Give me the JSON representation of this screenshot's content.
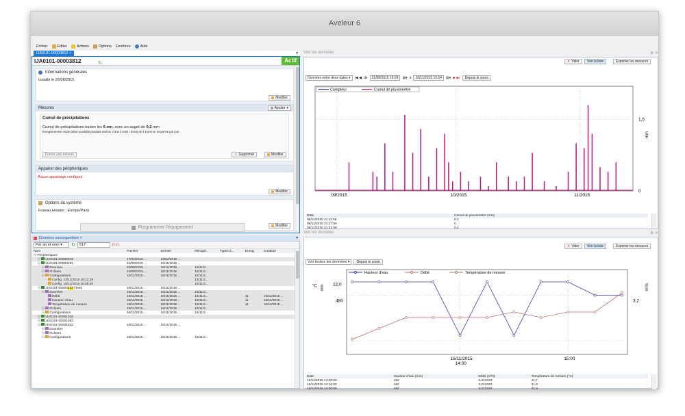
{
  "app": {
    "title": "Aveleur 6"
  },
  "menu": [
    {
      "label": "Fichier",
      "icon": ""
    },
    {
      "label": "Editer",
      "icon": "pencil-icon"
    },
    {
      "label": "Actions",
      "icon": "lightning-icon"
    },
    {
      "label": "Options",
      "icon": "wrench-icon"
    },
    {
      "label": "Fenêtres",
      "icon": ""
    },
    {
      "label": "Aide",
      "icon": "help-icon"
    }
  ],
  "left_tab": {
    "label": "IJA0101-00003812 ×"
  },
  "device": {
    "name": "IJA0101-00003812",
    "status": "Actif"
  },
  "info": {
    "heading": "Informations générales",
    "installed": "Installé le 25/08/2015",
    "modify": "Modifier"
  },
  "mesures": {
    "heading": "Mesures",
    "add": "Ajouter",
    "card_title": "Cumul de précipitations",
    "desc_pre": "Cumul de précipitations toutes les ",
    "desc_b1": "6 mn",
    "desc_mid": ", avec un auget de ",
    "desc_b2": "0,2",
    "desc_post": " mm",
    "note": "Enregistrement mode piéton possible pendant environ 2 ans 3 mois / Envoi de 4.8 ans en moyenne par jour",
    "force": "Forcer une mesure",
    "delete": "Supprimer",
    "modify": "Modifier"
  },
  "peripherals": {
    "heading": "Appairer des périphériques",
    "none": "Aucun appairage configuré",
    "modify": "Modifier"
  },
  "system": {
    "heading": "Options du système",
    "timezone": "Fuseau Horaire : Europe/Paris",
    "modify": "Modifier"
  },
  "program_button": "Programmer l'équipement",
  "saved": {
    "tab": "Données sauvegardées ×",
    "filter": "Par an et nom",
    "count": "517",
    "columns": [
      "Nom",
      "Premier",
      "Dernier",
      "Récupé...",
      "Types d...",
      "Enreg.",
      "Création"
    ],
    "rows": [
      {
        "ind": 0,
        "icon": "",
        "name": "Périphériques",
        "c": [
          "",
          "",
          "",
          "",
          "",
          ""
        ]
      },
      {
        "ind": 1,
        "icon": "signal",
        "name": "IJA0101-00000015",
        "c": [
          "17/02/2015 ...",
          "19/02/2015 ...",
          "",
          "",
          "",
          ""
        ],
        "g": 1
      },
      {
        "ind": 1,
        "icon": "signal",
        "name": "IJA0101-00000191",
        "c": [
          "24/09/2015 ...",
          "16/11/2015 ...",
          "",
          "",
          "",
          ""
        ]
      },
      {
        "ind": 2,
        "icon": "data",
        "name": "Données",
        "c": [
          "24/09/2015 ...",
          "16/11/2015 ...",
          "16/11/2...",
          "",
          "",
          ""
        ],
        "g": 1
      },
      {
        "ind": 2,
        "icon": "data",
        "name": "Fichiers",
        "c": [
          "24/09/2015 ...",
          "16/11/2015 ...",
          "16/11/2...",
          "",
          "",
          ""
        ],
        "g": 1
      },
      {
        "ind": 2,
        "icon": "cfg",
        "name": "Configurations",
        "c": [
          "13/11/2015 ...",
          "16/11/2015 ...",
          "16/11/2...",
          "",
          "",
          ""
        ],
        "g": 1
      },
      {
        "ind": 3,
        "icon": "cfg",
        "name": "Config. 13/11/2015 18:12:39",
        "c": [
          "",
          "",
          "13/11/2...",
          "",
          "",
          ""
        ],
        "g": 1
      },
      {
        "ind": 3,
        "icon": "cfg",
        "name": "Config. 16/11/2015 16:09:30",
        "c": [
          "",
          "",
          "16/11/2...",
          "",
          "",
          ""
        ],
        "g": 1
      },
      {
        "ind": 1,
        "icon": "signal",
        "name": "IJA0101-00000",
        "hl": "413",
        "suffix": " (Test)",
        "c": [
          "16/11/2015 ...",
          "16/11/2015 ...",
          "",
          "",
          "",
          ""
        ]
      },
      {
        "ind": 2,
        "icon": "data",
        "name": "Données",
        "c": [
          "16/11/2015 ...",
          "16/11/2015 ...",
          "16/11/2...",
          "",
          "",
          ""
        ],
        "g": 1
      },
      {
        "ind": 3,
        "icon": "data",
        "name": "Débit",
        "c": [
          "16/11/2015 ...",
          "16/11/2015 ...",
          "16/11/2...",
          "",
          "11",
          "16/11/2015 ..."
        ],
        "g": 1
      },
      {
        "ind": 3,
        "icon": "data",
        "name": "Hauteur d'eau",
        "c": [
          "16/11/2015 ...",
          "16/11/2015 ...",
          "16/11/2...",
          "",
          "11",
          "16/11/2015 ..."
        ],
        "g": 1
      },
      {
        "ind": 3,
        "icon": "data",
        "name": "Température de mesure",
        "c": [
          "16/11/2015 ...",
          "16/11/2015 ...",
          "16/11/2...",
          "",
          "11",
          "16/11/2015 ..."
        ],
        "g": 1
      },
      {
        "ind": 2,
        "icon": "data",
        "name": "Fichiers",
        "c": [
          "16/11/2015 ...",
          "16/11/2015 ...",
          "16/11/2...",
          "",
          "",
          ""
        ],
        "g": 1
      },
      {
        "ind": 2,
        "icon": "cfg",
        "name": "Configurations",
        "c": [
          "16/11/2015 ...",
          "16/11/2015 ...",
          "16/11/2...",
          "",
          "",
          ""
        ]
      },
      {
        "ind": 1,
        "icon": "signal",
        "name": "IJA0101-00001016",
        "c": [
          "",
          "",
          "",
          "",
          "",
          ""
        ],
        "g": 1
      },
      {
        "ind": 1,
        "icon": "signal",
        "name": "IJA0101-00001093",
        "c": [
          "",
          "",
          "",
          "",
          "",
          ""
        ]
      },
      {
        "ind": 1,
        "icon": "signal",
        "name": "IJA0101-00001532",
        "c": [
          "16/11/2015 ...",
          "16/11/2015 ...",
          "",
          "",
          "",
          ""
        ]
      },
      {
        "ind": 2,
        "icon": "data",
        "name": "Données",
        "c": [
          "",
          "",
          "",
          "",
          "",
          ""
        ]
      },
      {
        "ind": 2,
        "icon": "data",
        "name": "Fichiers",
        "c": [
          "",
          "",
          "",
          "",
          "",
          ""
        ]
      },
      {
        "ind": 2,
        "icon": "cfg",
        "name": "Configurations",
        "c": [
          "16/11/2015 ...",
          "16/11/2015 ...",
          "16/11/2...",
          "",
          "",
          ""
        ]
      }
    ]
  },
  "view1": {
    "title": "Voir les données",
    "clear": "Vider",
    "list": "Voir la liste",
    "export": "Exporter les mesures",
    "range": "Données entre deux dates",
    "de": "de",
    "date_from": "31/08/2015 16:29",
    "a": "à",
    "date_to": "16/11/2015 15:54",
    "zoom": "Depuis le zoom",
    "table": {
      "columns": [
        "Date",
        "Cumul de pluviomètre (mm)"
      ],
      "rows": [
        [
          "06/11/2015 21:11:59",
          "0,2"
        ],
        [
          "06/11/2015 21:17:59",
          "0"
        ],
        [
          "06/11/2015 21:23:59",
          "0,4"
        ]
      ]
    }
  },
  "view2": {
    "title": "Voir les données",
    "clear": "Vider",
    "list": "Voir la liste",
    "export": "Exporter les mesures",
    "range": "Voir toutes les données",
    "zoom": "Depuis le zoom",
    "table": {
      "columns": [
        "Date",
        "Hauteur d'eau (mm)",
        "Débit (m³/s)",
        "Température de mesure (°C)"
      ],
      "rows": [
        [
          "16/11/2015 13:00:00",
          "482",
          "3,213333",
          "21,7"
        ],
        [
          "16/11/2015 13:15:00",
          "482",
          "3,213333",
          "21,8"
        ],
        [
          "16/11/2015 13:30:00",
          "482",
          "3,213333",
          "21,9"
        ]
      ]
    }
  },
  "chart_data": [
    {
      "type": "bar",
      "legend": [
        "Compteur",
        "Cumul de pluviomètre"
      ],
      "x_ticks": [
        "09/2015",
        "10/2015",
        "11/2015"
      ],
      "y_ticks": [
        "0",
        "1,5"
      ],
      "ylabel": "mm",
      "ylim": [
        0,
        2.2
      ],
      "colors": {
        "series": "#c0147e",
        "compteur": "#2b3fa8"
      },
      "x": [
        "09-08",
        "09-14",
        "09-15",
        "09-17",
        "09-19",
        "09-22",
        "09-24",
        "09-26",
        "09-28",
        "09-30",
        "10-02",
        "10-03",
        "10-04",
        "10-06",
        "10-08",
        "10-11",
        "10-13",
        "10-15",
        "10-18",
        "10-20",
        "10-22",
        "10-24",
        "10-27",
        "10-30",
        "11-02",
        "11-04",
        "11-06",
        "11-07",
        "11-08",
        "11-10",
        "11-12",
        "11-14"
      ],
      "values": [
        0.6,
        0.4,
        0.3,
        1.0,
        0.4,
        1.6,
        0.8,
        1.3,
        0.3,
        0.9,
        1.2,
        0.6,
        0.2,
        0.4,
        0.2,
        0.3,
        0.1,
        0.6,
        0.3,
        0.2,
        0.3,
        0.8,
        0.2,
        0.1,
        0.4,
        1.0,
        0.9,
        1.8,
        1.2,
        0.5,
        0.4,
        0.6
      ]
    },
    {
      "type": "line",
      "legend": [
        "Hauteur d'eau",
        "Débit",
        "Température de mesure"
      ],
      "colors": [
        "#3a3aa5",
        "#b57070",
        "#a37a7a"
      ],
      "x_ticks": [
        "16/11/2015 14:00",
        "15:00"
      ],
      "y_left": [
        "22,0",
        "480"
      ],
      "y_left_labels": [
        "°C",
        "mm"
      ],
      "y_right": [
        "3,2"
      ],
      "y_right_label": "m³/s",
      "x": [
        "13:00",
        "13:15",
        "13:30",
        "13:45",
        "14:00",
        "14:15",
        "14:30",
        "14:45",
        "15:00",
        "15:15",
        "15:30"
      ],
      "series": [
        {
          "name": "Hauteur d'eau",
          "values": [
            482,
            482,
            482,
            482,
            474,
            482,
            474,
            482,
            482,
            480,
            480
          ]
        },
        {
          "name": "Débit",
          "values": [
            3.0,
            3.08,
            3.16,
            3.16,
            3.16,
            3.16,
            3.2,
            3.16,
            3.2,
            3.2,
            3.34
          ]
        }
      ]
    }
  ]
}
